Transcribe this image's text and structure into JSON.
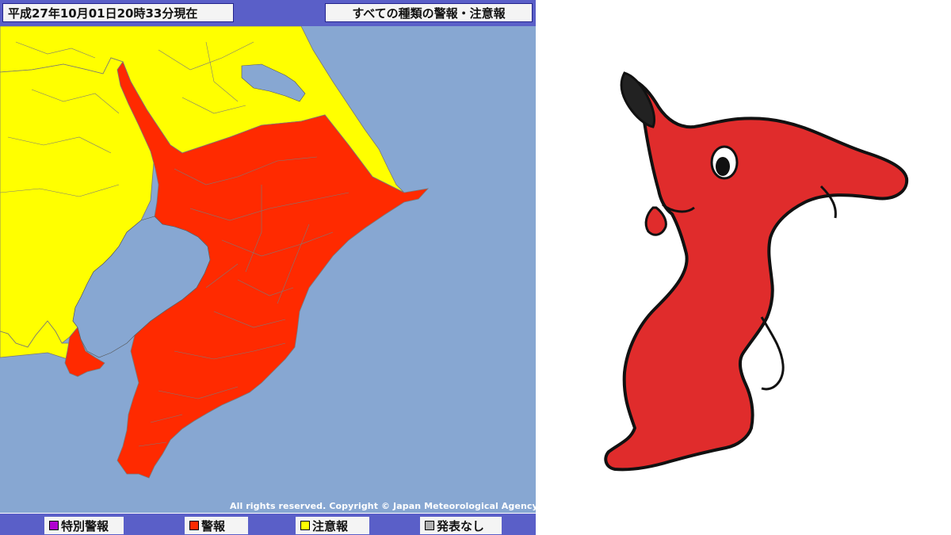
{
  "map": {
    "timestamp": "平成27年10月01日20時33分現在",
    "title": "すべての種類の警報・注意報",
    "copyright": "All rights reserved. Copyright © Japan Meteorological Agency",
    "colors": {
      "sea": "#87a7d2",
      "warning": "#ff2a00",
      "advisory": "#ffff00",
      "header": "#5a5fc8"
    },
    "legend": [
      {
        "label": "特別警報",
        "color": "#b000d0"
      },
      {
        "label": "警報",
        "color": "#ff2a00"
      },
      {
        "label": "注意報",
        "color": "#ffff00"
      },
      {
        "label": "発表なし",
        "color": "#b0b0b0"
      }
    ]
  },
  "mascot": {
    "body_color": "#e02c2c",
    "ear_tip_color": "#222222"
  }
}
